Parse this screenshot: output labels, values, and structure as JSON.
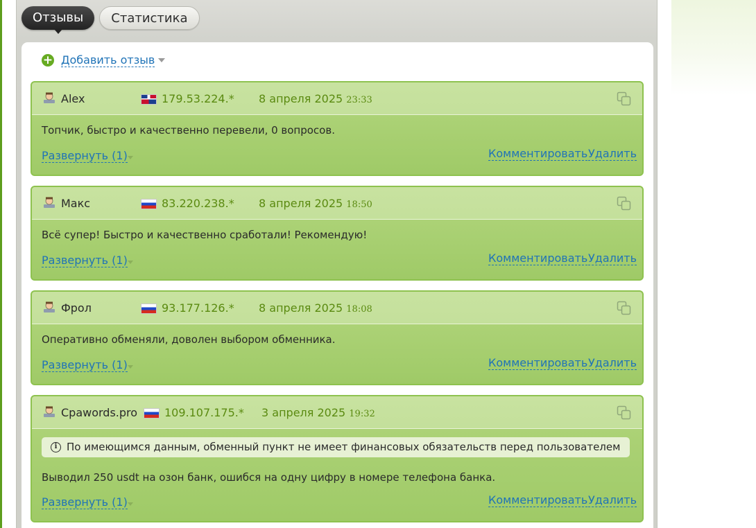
{
  "tabs": [
    {
      "label": "Отзывы",
      "active": true
    },
    {
      "label": "Статистика",
      "active": false
    }
  ],
  "add_review": {
    "label": "Добавить отзыв"
  },
  "reviews": [
    {
      "name": "Alex",
      "flag": "dominican-republic-flag-icon",
      "ip": "179.53.224.*",
      "date": "8 апреля 2025",
      "time": "23:33",
      "text": "Топчик, быстро и качественно перевели, 0 вопросов.",
      "expand": "Развернуть (1)",
      "comment": "Комментировать",
      "delete": "Удалить"
    },
    {
      "name": "Макс",
      "flag": "russia-flag-icon",
      "ip": "83.220.238.*",
      "date": "8 апреля 2025",
      "time": "18:50",
      "text": "Всё супер! Быстро и качественно сработали! Рекомендую!",
      "expand": "Развернуть (1)",
      "comment": "Комментировать",
      "delete": "Удалить"
    },
    {
      "name": "Фрол",
      "flag": "russia-flag-icon",
      "ip": "93.177.126.*",
      "date": "8 апреля 2025",
      "time": "18:08",
      "text": "Оперативно обменяли, доволен выбором обменника.",
      "expand": "Развернуть (1)",
      "comment": "Комментировать",
      "delete": "Удалить"
    },
    {
      "name": "Cpawords.pro",
      "flag": "russia-flag-icon",
      "ip": "109.107.175.*",
      "date": "3 апреля 2025",
      "time": "19:32",
      "notice": "По имеющимся данным, обменный пункт не имеет финансовых обязательств перед пользователем",
      "text": "Выводил 250 usdt на озон банк, ошибся на одну цифру в номере телефона банка.",
      "expand": "Развернуть (1)",
      "comment": "Комментировать",
      "delete": "Удалить"
    }
  ],
  "colors": {
    "accent_green": "#67ab22",
    "link_blue": "#1f73b7",
    "card_header": "#c6e19d",
    "card_body": "#a5ce6e",
    "meta_green": "#5a8a10"
  }
}
